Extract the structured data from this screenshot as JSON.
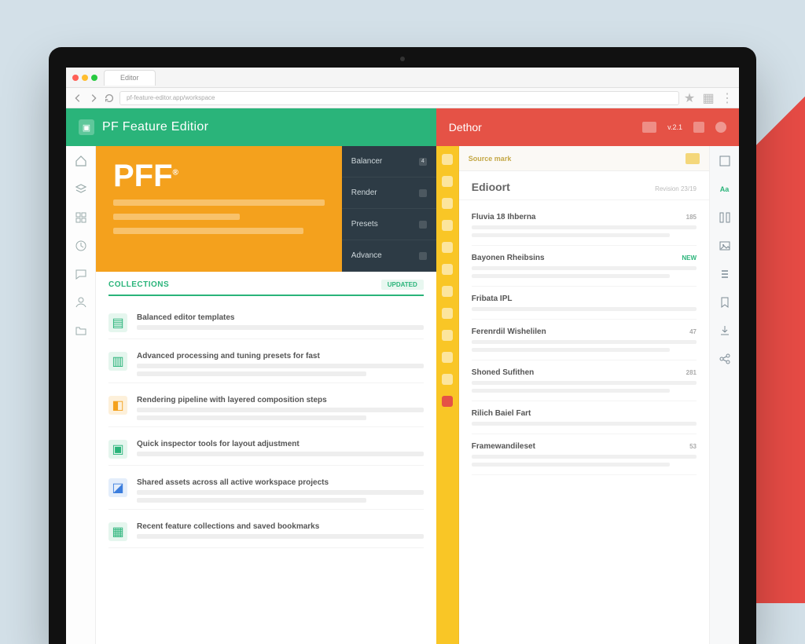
{
  "browser": {
    "tab_label": "Editor",
    "url": "pf-feature-editor.app/workspace"
  },
  "topbar": {
    "left_title": "PF Feature Editior",
    "right_title": "Dethor",
    "right_meta": "v.2.1"
  },
  "hero": {
    "title": "PFF",
    "sup": "®",
    "nav": [
      {
        "label": "Balancer",
        "badge": "4"
      },
      {
        "label": "Render",
        "badge": ""
      },
      {
        "label": "Presets",
        "badge": ""
      },
      {
        "label": "Advance",
        "badge": ""
      }
    ]
  },
  "left_list": {
    "header": "Collections",
    "header_tag": "UPDATED",
    "rows": [
      {
        "title": "Balanced editor templates",
        "icon": "green"
      },
      {
        "title": "Advanced processing and tuning presets for fast",
        "icon": "green"
      },
      {
        "title": "Rendering pipeline with layered composition steps",
        "icon": "orange"
      },
      {
        "title": "Quick inspector tools for layout adjustment",
        "icon": "green"
      },
      {
        "title": "Shared assets across all active workspace projects",
        "icon": "blue"
      },
      {
        "title": "Recent feature collections and saved bookmarks",
        "icon": "green"
      }
    ]
  },
  "right": {
    "tab": "Source mark",
    "panel_title": "Edioort",
    "panel_meta": "Revision 23/19",
    "items": [
      {
        "name": "Fluvia 18 Ihberna",
        "badge": "185",
        "badge_style": ""
      },
      {
        "name": "Bayonen Rheibsins",
        "badge": "NEW",
        "badge_style": "green"
      },
      {
        "name": "Fribata IPL",
        "badge": "",
        "badge_style": ""
      },
      {
        "name": "Ferenrdil Wishelilen",
        "badge": "47",
        "badge_style": ""
      },
      {
        "name": "Shoned Sufithen",
        "badge": "281",
        "badge_style": ""
      },
      {
        "name": "Rilich Baiel Fart",
        "badge": "",
        "badge_style": ""
      },
      {
        "name": "Framewandileset",
        "badge": "53",
        "badge_style": ""
      }
    ]
  },
  "colors": {
    "green": "#2ab47a",
    "red": "#e55246",
    "orange": "#f4a11d",
    "yellow": "#f9c626",
    "navy": "#2d3b45"
  }
}
